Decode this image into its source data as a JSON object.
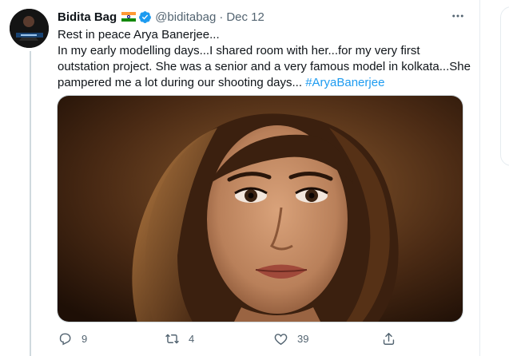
{
  "tweet": {
    "author_name": "Bidita Bag",
    "flag_icon": "india-flag-icon",
    "verified_icon": "verified-badge-icon",
    "handle": "@biditabag",
    "separator": "·",
    "date": "Dec 12",
    "text_lines": [
      "Rest in peace Arya Banerjee...",
      "In my early modelling days...I shared room with her...for my very first",
      "outstation project. She was a senior and a very famous model in kolkata...She",
      "pampered me a lot during our shooting days... "
    ],
    "hashtag": "#AryaBanerjee",
    "image_alt": "Photo of Arya Banerjee"
  },
  "actions": {
    "reply_count": "9",
    "retweet_count": "4",
    "like_count": "39"
  },
  "colors": {
    "link": "#1d9bf0",
    "secondary_text": "#536471",
    "verified": "#1d9bf0"
  }
}
